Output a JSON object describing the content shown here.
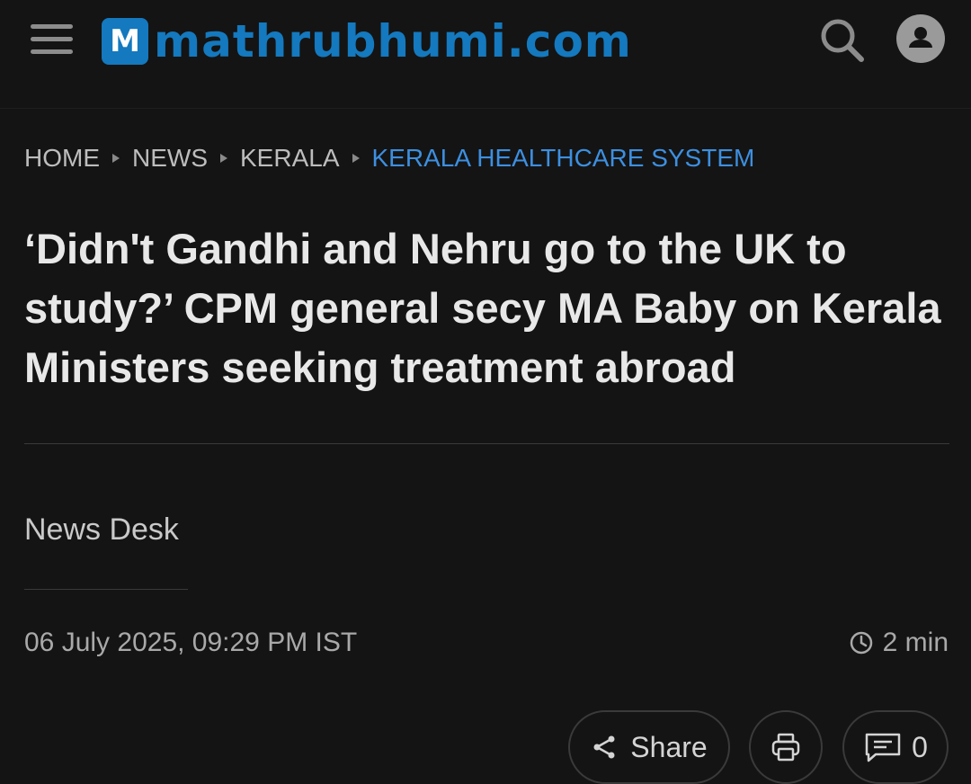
{
  "header": {
    "logo_badge": "M",
    "logo_text": "mathrubhumi.com",
    "icons": [
      "menu-icon",
      "search-icon",
      "user-icon"
    ],
    "brand_color": "#1479be"
  },
  "breadcrumb": [
    {
      "label": "HOME"
    },
    {
      "label": "NEWS"
    },
    {
      "label": "KERALA"
    },
    {
      "label": "KERALA HEALTHCARE SYSTEM",
      "active": true
    }
  ],
  "breadcrumb_active_color": "#3d8fe0",
  "article": {
    "headline": "‘Didn't Gandhi and Nehru go to the UK to study?’ CPM general secy MA Baby on Kerala Ministers seeking treatment abroad",
    "author": "News Desk",
    "datetime": "06 July 2025, 09:29 PM IST",
    "read_time": "2 min"
  },
  "actions": {
    "share_label": "Share",
    "comment_count": "0",
    "icons": [
      "share-icon",
      "print-icon",
      "comment-icon",
      "clock-icon"
    ]
  }
}
